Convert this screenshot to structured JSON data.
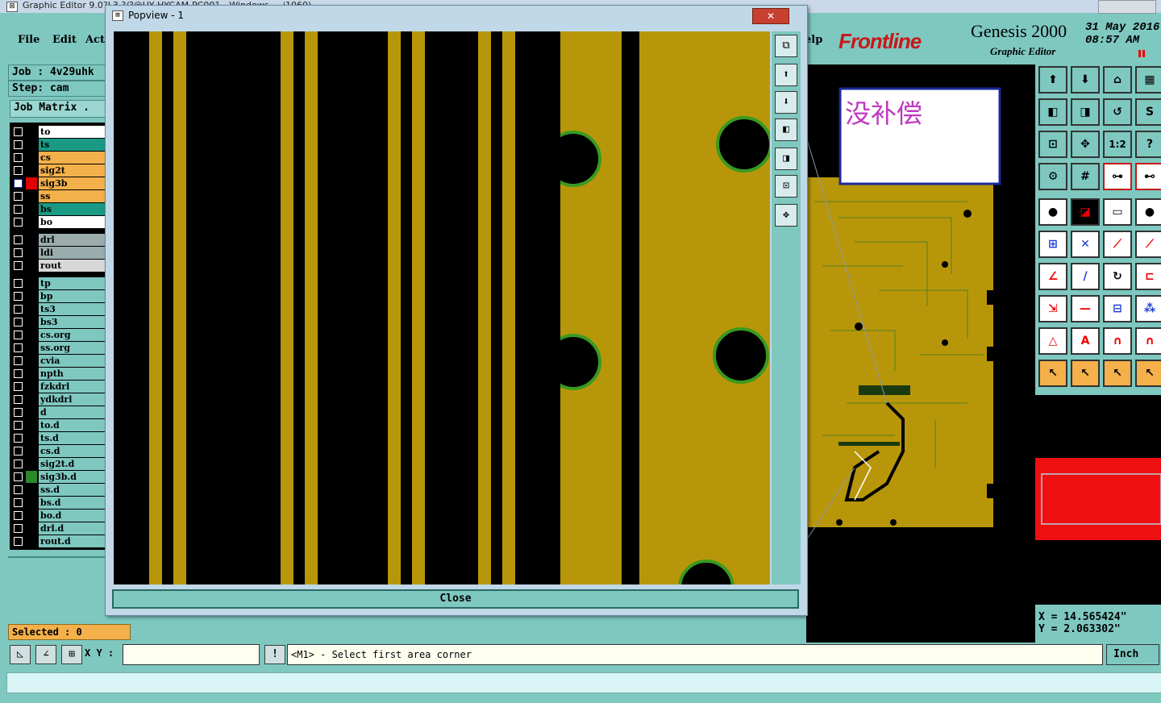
{
  "window": {
    "title": "Graphic Editor 9.0?L3 ?/?@UY HYCAM-PC001 - Windows ... i1060)",
    "icon_glyph": "⊠"
  },
  "menu": {
    "items": [
      "File",
      "Edit",
      "Act"
    ],
    "help_fragment": "elp"
  },
  "job": {
    "job_label": "Job : 4v29uhk",
    "step_label": "Step: cam",
    "matrix_button": "Job Matrix ."
  },
  "layers": [
    {
      "name": "to",
      "bg": "#ffffff",
      "mark": "#000"
    },
    {
      "name": "ts",
      "bg": "#1a9a84",
      "mark": "#000"
    },
    {
      "name": "cs",
      "bg": "#f4b04a",
      "mark": "#000"
    },
    {
      "name": "sig2t",
      "bg": "#f4b04a",
      "mark": "#000"
    },
    {
      "name": "sig3b",
      "bg": "#f4b04a",
      "mark": "#e00000",
      "selected": true
    },
    {
      "name": "ss",
      "bg": "#f4b04a",
      "mark": "#000"
    },
    {
      "name": "bs",
      "bg": "#1a9a84",
      "mark": "#000"
    },
    {
      "name": "bo",
      "bg": "#ffffff",
      "mark": "#000"
    },
    {
      "name": "drl",
      "bg": "#9aacac",
      "mark": "#000"
    },
    {
      "name": "ldi",
      "bg": "#9aacac",
      "mark": "#000"
    },
    {
      "name": "rout",
      "bg": "#d8d8d8",
      "mark": "#000"
    },
    {
      "name": "tp",
      "bg": "#7ec8c0",
      "mark": "#000"
    },
    {
      "name": "bp",
      "bg": "#7ec8c0",
      "mark": "#000"
    },
    {
      "name": "ts3",
      "bg": "#7ec8c0",
      "mark": "#000"
    },
    {
      "name": "bs3",
      "bg": "#7ec8c0",
      "mark": "#000"
    },
    {
      "name": "cs.org",
      "bg": "#7ec8c0",
      "mark": "#000"
    },
    {
      "name": "ss.org",
      "bg": "#7ec8c0",
      "mark": "#000"
    },
    {
      "name": "cvia",
      "bg": "#7ec8c0",
      "mark": "#000"
    },
    {
      "name": "npth",
      "bg": "#7ec8c0",
      "mark": "#000"
    },
    {
      "name": "fzkdrl",
      "bg": "#7ec8c0",
      "mark": "#000"
    },
    {
      "name": "ydkdrl",
      "bg": "#7ec8c0",
      "mark": "#000"
    },
    {
      "name": "d",
      "bg": "#7ec8c0",
      "mark": "#000"
    },
    {
      "name": "to.d",
      "bg": "#7ec8c0",
      "mark": "#000"
    },
    {
      "name": "ts.d",
      "bg": "#7ec8c0",
      "mark": "#000"
    },
    {
      "name": "cs.d",
      "bg": "#7ec8c0",
      "mark": "#000"
    },
    {
      "name": "sig2t.d",
      "bg": "#7ec8c0",
      "mark": "#000"
    },
    {
      "name": "sig3b.d",
      "bg": "#7ec8c0",
      "mark": "#2a8a2a"
    },
    {
      "name": "ss.d",
      "bg": "#7ec8c0",
      "mark": "#000"
    },
    {
      "name": "bs.d",
      "bg": "#7ec8c0",
      "mark": "#000"
    },
    {
      "name": "bo.d",
      "bg": "#7ec8c0",
      "mark": "#000"
    },
    {
      "name": "drl.d",
      "bg": "#7ec8c0",
      "mark": "#000"
    },
    {
      "name": "rout.d",
      "bg": "#7ec8c0",
      "mark": "#000"
    }
  ],
  "selected_label": "Selected : 0",
  "bottom": {
    "xy_label": "X Y :",
    "xy_value": "",
    "bang": "!",
    "message": "<M1> - Select first area corner",
    "unit": "Inch"
  },
  "brand": {
    "logo": "Frontline",
    "product": "Genesis 2000",
    "subtitle": "Graphic Editor",
    "date": "31 May 2016",
    "time": "08:57 AM"
  },
  "coords": {
    "x": "X = 14.565424\"",
    "y": "Y = 2.063302\""
  },
  "popup": {
    "title": "Popview - 1",
    "close_label": "Close",
    "x_label": "✕"
  },
  "note": {
    "text": "没补偿"
  },
  "colors": {
    "copper": "#b8960a",
    "panel": "#7ec8c0",
    "ring": "#3a9a20",
    "board_bg": "#000000"
  }
}
